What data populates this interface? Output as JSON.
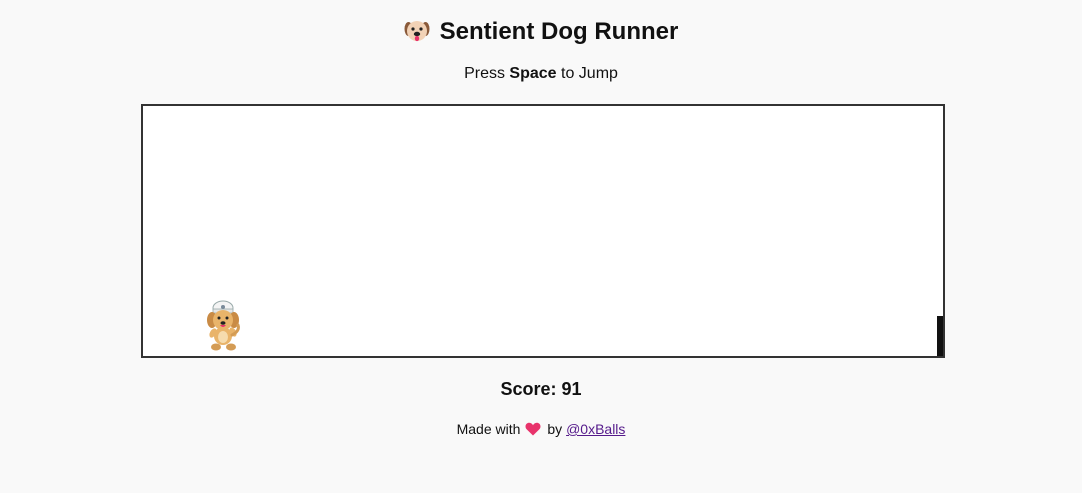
{
  "header": {
    "title": "Sentient Dog Runner",
    "title_icon": "dog-face-icon"
  },
  "instructions": {
    "prefix": "Press",
    "key": "Space",
    "suffix": "to Jump"
  },
  "game": {
    "player_icon": "dog-sprite",
    "obstacle_icon": "black-bar-obstacle"
  },
  "score": {
    "label": "Score:",
    "value": "91"
  },
  "footer": {
    "made_with": "Made with",
    "heart_icon": "heart-icon",
    "by": "by",
    "author_link": "@0xBalls"
  },
  "colors": {
    "background": "#f9f9f9",
    "canvas_border": "#333333",
    "link": "#551a8b",
    "heart": "#e8336b"
  }
}
